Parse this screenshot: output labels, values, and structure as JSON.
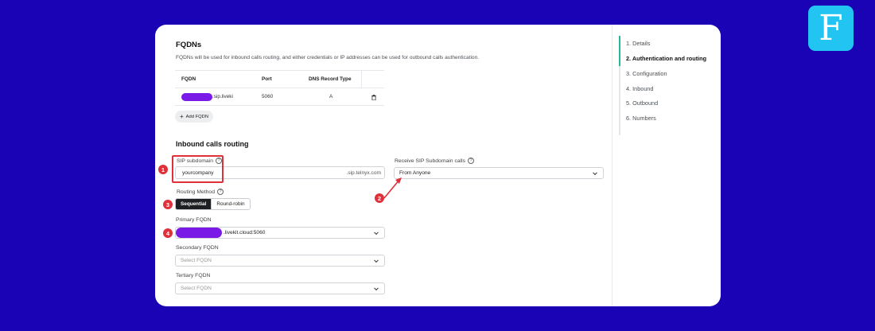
{
  "brand": {
    "logo_letter": "F",
    "accent": "#22c4f2",
    "background": "#1a03b4"
  },
  "fqdns": {
    "title": "FQDNs",
    "description": "FQDNs will be used for inbound calls routing, and either credentials or IP addresses can be used for outbound calls authentication.",
    "columns": [
      "FQDN",
      "Port",
      "DNS Record Type"
    ],
    "row": {
      "fqdn": ":sip.liveki",
      "port": "5060",
      "record_type": "A"
    },
    "add_label": "Add FQDN",
    "add_icon": "plus-icon",
    "delete_icon": "trash-icon"
  },
  "inbound": {
    "title": "Inbound calls routing",
    "sip_subdomain_label": "SIP subdomain",
    "sip_subdomain_value": "yourcompany",
    "sip_suffix": ".sip.telnyx.com",
    "receive_label": "Receive SIP Subdomain calls",
    "receive_value": "From Anyone",
    "routing_label": "Routing Method",
    "routing_options": [
      "Sequential",
      "Round-robin"
    ],
    "routing_selected": "Sequential",
    "primary_label": "Primary FQDN",
    "primary_value": ".livekit.cloud:5060",
    "secondary_label": "Secondary FQDN",
    "secondary_placeholder": "Select FQDN",
    "tertiary_label": "Tertiary FQDN",
    "tertiary_placeholder": "Select FQDN"
  },
  "annotations": [
    "1",
    "2",
    "3",
    "4"
  ],
  "highlight_color": "#e0303a",
  "steps": [
    {
      "label": "1. Details"
    },
    {
      "label": "2. Authentication and routing",
      "active": true
    },
    {
      "label": "3. Configuration"
    },
    {
      "label": "4. Inbound"
    },
    {
      "label": "5. Outbound"
    },
    {
      "label": "6. Numbers"
    }
  ]
}
